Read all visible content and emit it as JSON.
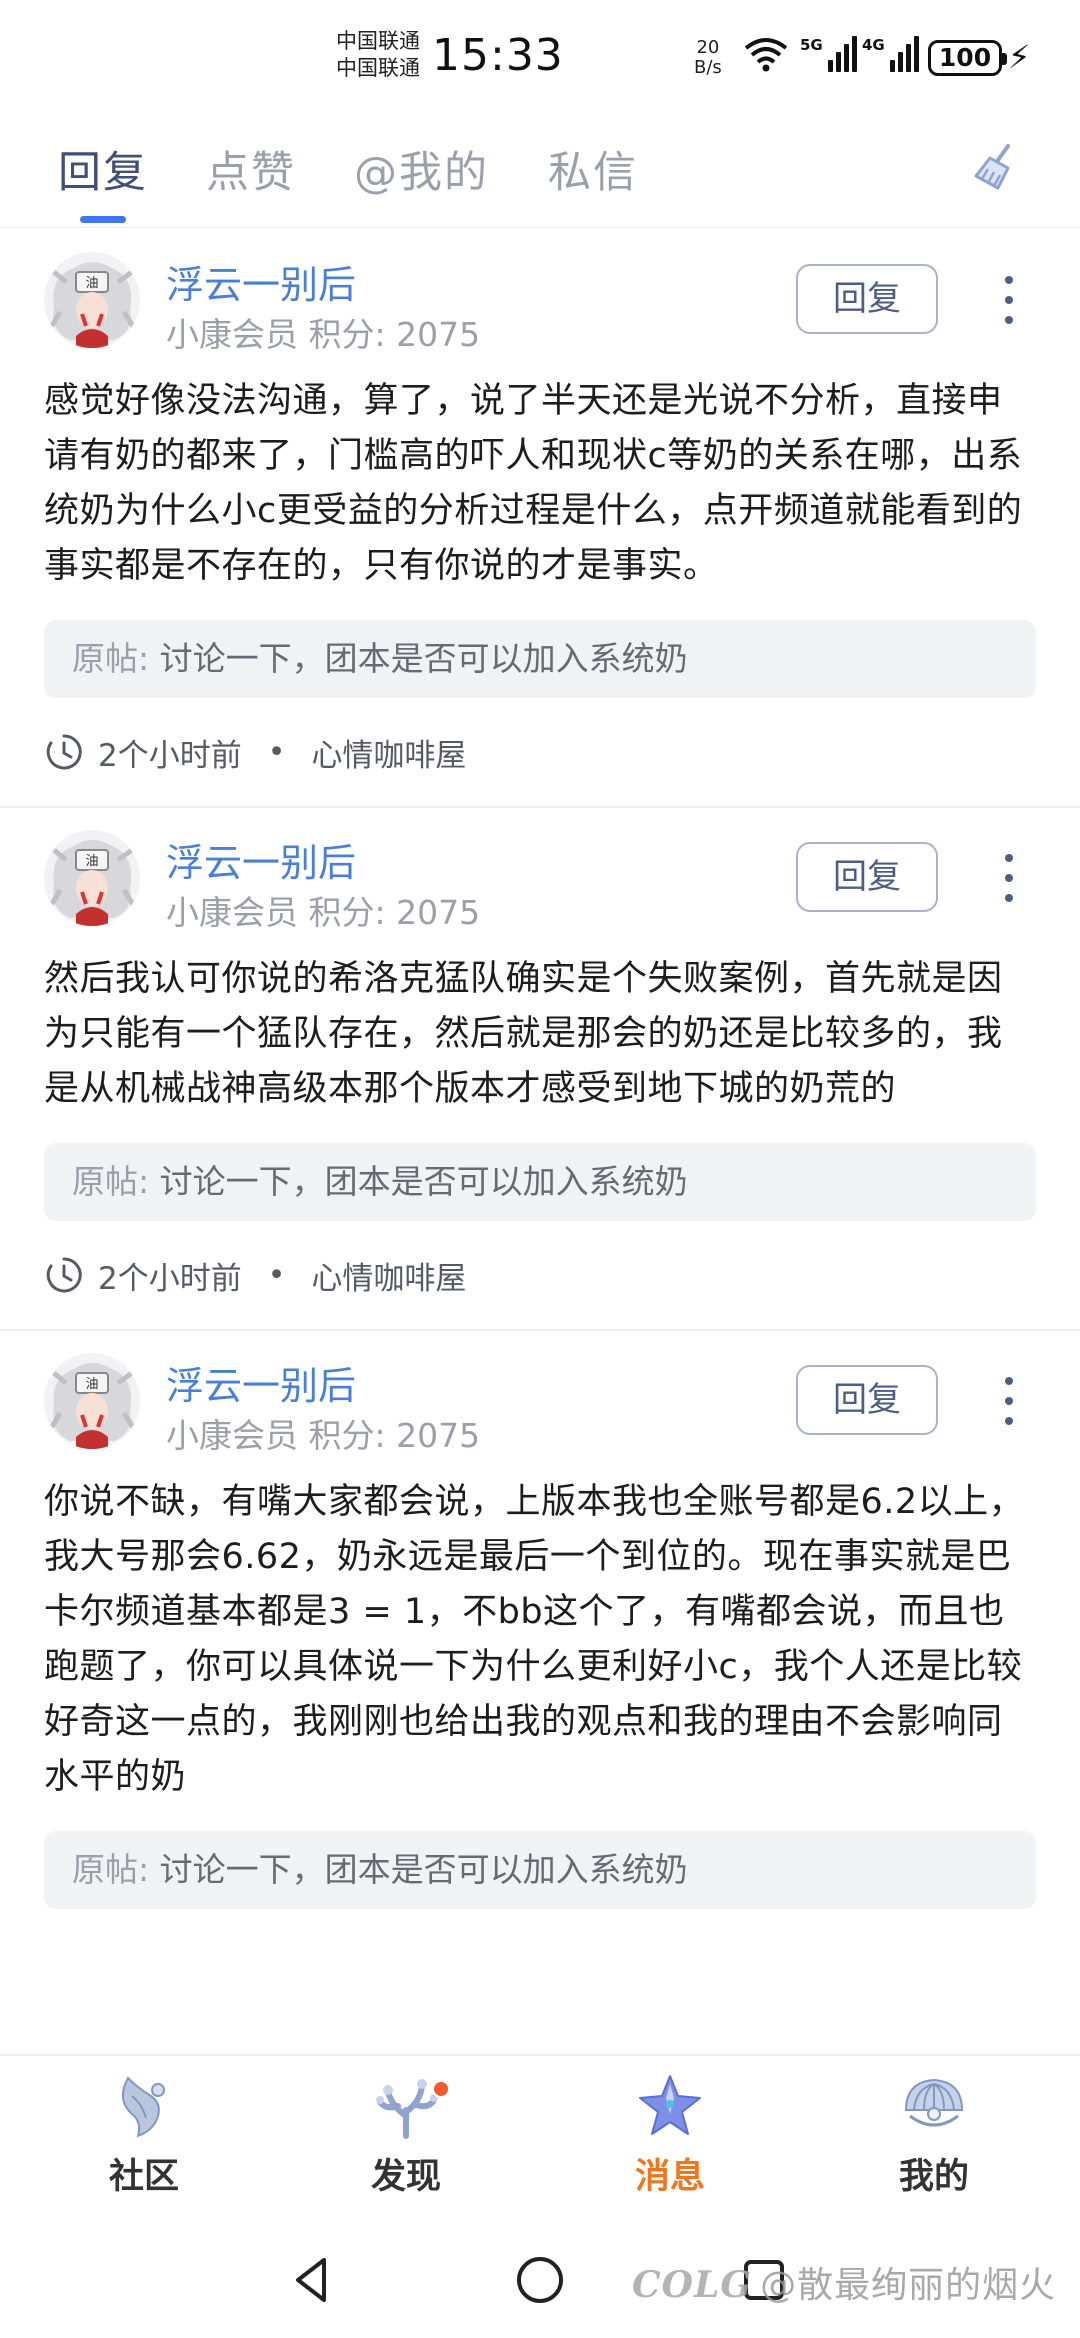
{
  "status_bar": {
    "carrier_1": "中国联通",
    "carrier_2": "中国联通",
    "time": "15:33",
    "speed_value": "20",
    "speed_unit": "B/s",
    "sig1_tag": "5G",
    "sig2_tag": "4G",
    "battery": "100"
  },
  "tabs": [
    {
      "label": "回复",
      "active": true
    },
    {
      "label": "点赞",
      "active": false
    },
    {
      "label": "@我的",
      "active": false
    },
    {
      "label": "私信",
      "active": false
    }
  ],
  "replies": [
    {
      "username": "浮云一别后",
      "member": "小康会员 积分: 2075",
      "reply_label": "回复",
      "content": "感觉好像没法沟通，算了，说了半天还是光说不分析，直接申请有奶的都来了，门槛高的吓人和现状c等奶的关系在哪，出系统奶为什么小c更受益的分析过程是什么，点开频道就能看到的事实都是不存在的，只有你说的才是事实。",
      "origin_label": "原帖:",
      "origin_title": "讨论一下，团本是否可以加入系统奶",
      "time": "2个小时前",
      "channel": "心情咖啡屋"
    },
    {
      "username": "浮云一别后",
      "member": "小康会员 积分: 2075",
      "reply_label": "回复",
      "content": "然后我认可你说的希洛克猛队确实是个失败案例，首先就是因为只能有一个猛队存在，然后就是那会的奶还是比较多的，我是从机械战神高级本那个版本才感受到地下城的奶荒的",
      "origin_label": "原帖:",
      "origin_title": "讨论一下，团本是否可以加入系统奶",
      "time": "2个小时前",
      "channel": "心情咖啡屋"
    },
    {
      "username": "浮云一别后",
      "member": "小康会员 积分: 2075",
      "reply_label": "回复",
      "content": "你说不缺，有嘴大家都会说，上版本我也全账号都是6.2以上，我大号那会6.62，奶永远是最后一个到位的。现在事实就是巴卡尔频道基本都是3 = 1，不bb这个了，有嘴都会说，而且也跑题了，你可以具体说一下为什么更利好小c，我个人还是比较好奇这一点的，我刚刚也给出我的观点和我的理由不会影响同水平的奶",
      "origin_label": "原帖:",
      "origin_title": "讨论一下，团本是否可以加入系统奶",
      "time": "",
      "channel": ""
    }
  ],
  "meta_separator": "•",
  "bottom_nav": [
    {
      "label": "社区",
      "icon": "community-icon",
      "active": false
    },
    {
      "label": "发现",
      "icon": "discover-icon",
      "active": false,
      "badge": true
    },
    {
      "label": "消息",
      "icon": "message-icon",
      "active": true
    },
    {
      "label": "我的",
      "icon": "profile-icon",
      "active": false
    }
  ],
  "watermark": {
    "logo": "COLG",
    "text": "@散最绚丽的烟火"
  },
  "colors": {
    "accent": "#3f74f3",
    "username": "#4a7fd6",
    "active_nav": "#f0761e"
  }
}
